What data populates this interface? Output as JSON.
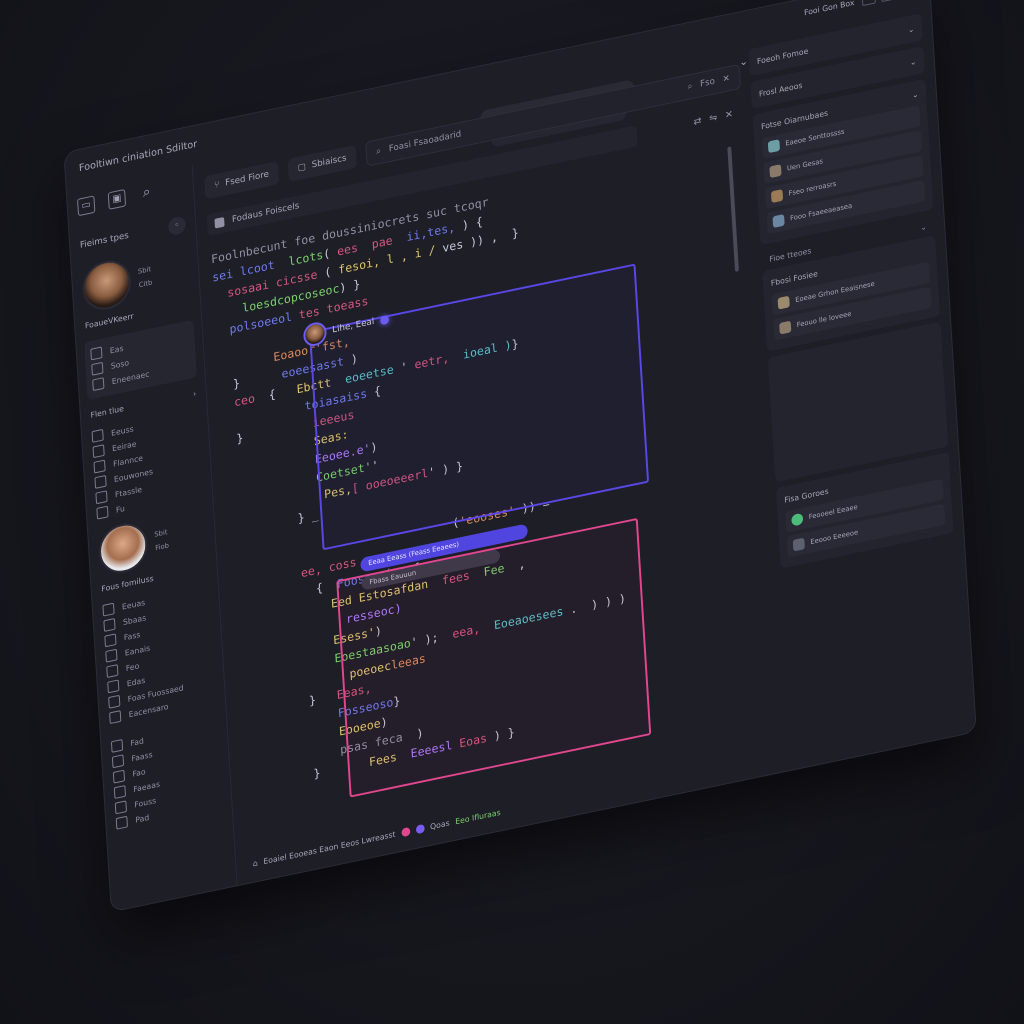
{
  "app": {
    "title": "Fooltiwn ciniation Sdiltor",
    "top_right_label": "Fooi Gon Box"
  },
  "header": {
    "close_icon": "close-icon",
    "check_icon": "check-icon"
  },
  "sidebar": {
    "files_label": "Fieims tpes",
    "user1": {
      "meta1": "Sbit",
      "meta2": "Citb",
      "name": "FoaueVKeerr"
    },
    "box_items": [
      "Eas",
      "Soso",
      "Eneenaec"
    ],
    "collapse_label": "Flen tlue",
    "list1": [
      "Eeuss",
      "Eeirae",
      "Flannce",
      "Eouwones",
      "Ftassle",
      "Fu"
    ],
    "user2": {
      "meta1": "Sbit",
      "meta2": "Fiob",
      "name": "Fous fomiluss"
    },
    "list2": [
      "Eeuas",
      "Sbaas",
      "Fass",
      "Eanais",
      "Feo",
      "Edas",
      "Foas Fuossaed",
      "Eacensaro"
    ],
    "list3": [
      "Fad",
      "Faass",
      "Fao",
      "Faeaas",
      "Fouss",
      "Pad"
    ]
  },
  "editor": {
    "tab_label": "Fsed Fiore",
    "tab2_label": "Sbiaiscs",
    "search_placeholder": "Foasi Fsaoadarid",
    "search_term": "Fso",
    "breadcrumb": "Fodaus Foiscels",
    "code_header": "Foolnbecunt foe doussiniocrets suc tcoqr",
    "presence_user": "Lihe, Eeal",
    "chip_blue": "Eeaa Eeass (Feass Eeaees)",
    "chip_grey": "Fbass Eauuun",
    "status_text": "Eoaiel Eooeas Eaon Eeos Lwreasst",
    "status_values": [
      "Qoas",
      "Eeo Ifluraas"
    ]
  },
  "right_panel": {
    "section1": "Foeoh Fomoe",
    "section2": "Frosl Aeoos",
    "section3": "Fotse Oiarnubaes",
    "items1": [
      "Eaeoe Sonttossss",
      "Uen Gesas",
      "Fseo rerroasrs",
      "Fooo Fsaeeaeasea"
    ],
    "plain1": "Fioe tteoes",
    "section4": "Fbosi Fosiee",
    "items2": [
      "Eoeae Grhon Eeaisnese",
      "Feouo lle loveee"
    ],
    "section5": "Fisa Goroes",
    "items3": [
      "Feooeel Eeaee",
      "Eeooo Eeeeoe"
    ]
  },
  "colors": {
    "accent_blue": "#5a47e6",
    "accent_pink": "#e0478f",
    "toggle_green": "#b9e62a",
    "background": "#15151c"
  }
}
